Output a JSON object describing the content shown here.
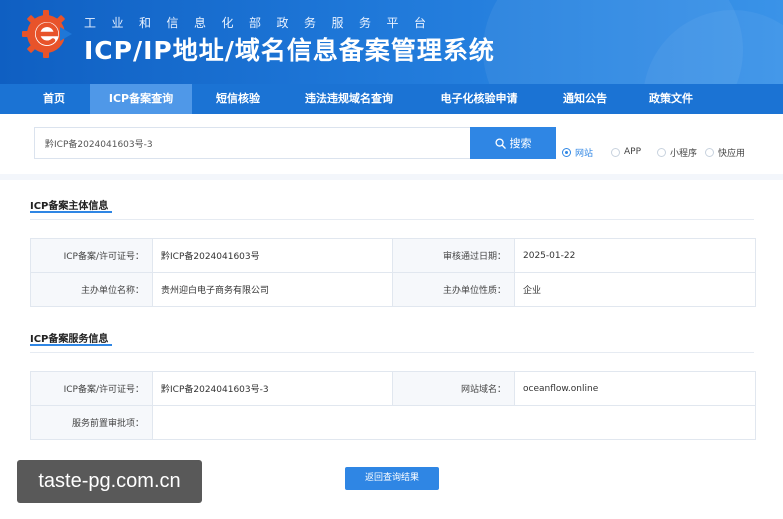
{
  "header": {
    "subtitle": "工业和信息化部政务服务平台",
    "title": "ICP/IP地址/域名信息备案管理系统"
  },
  "nav": {
    "items": [
      {
        "label": "首页"
      },
      {
        "label": "ICP备案查询"
      },
      {
        "label": "短信核验"
      },
      {
        "label": "违法违规域名查询"
      },
      {
        "label": "电子化核验申请"
      },
      {
        "label": "通知公告"
      },
      {
        "label": "政策文件"
      }
    ],
    "active_index": 1
  },
  "search": {
    "value": "黔ICP备2024041603号-3",
    "button_label": "搜索",
    "radios": [
      {
        "label": "网站",
        "checked": true
      },
      {
        "label": "APP",
        "checked": false
      },
      {
        "label": "小程序",
        "checked": false
      },
      {
        "label": "快应用",
        "checked": false
      }
    ]
  },
  "subject_section": {
    "title": "ICP备案主体信息",
    "rows": [
      {
        "label1": "ICP备案/许可证号：",
        "value1": "黔ICP备2024041603号",
        "label2": "审核通过日期：",
        "value2": "2025-01-22"
      },
      {
        "label1": "主办单位名称：",
        "value1": "贵州迎白电子商务有限公司",
        "label2": "主办单位性质：",
        "value2": "企业"
      }
    ]
  },
  "service_section": {
    "title": "ICP备案服务信息",
    "rows": [
      {
        "label1": "ICP备案/许可证号：",
        "value1": "黔ICP备2024041603号-3",
        "label2": "网站域名：",
        "value2": "oceanflow.online"
      },
      {
        "label1": "服务前置审批项：",
        "value1": ""
      }
    ]
  },
  "back_button_label": "返回查询结果",
  "watermark": "taste-pg.com.cn",
  "colors": {
    "header_blue": "#1e77d8",
    "nav_blue": "#1b73d4",
    "nav_active": "#4f98e8",
    "accent": "#2f86e4",
    "logo_orange": "#e8532a"
  },
  "icons": {
    "logo": "gear-e-logo-icon",
    "search": "search-icon"
  }
}
